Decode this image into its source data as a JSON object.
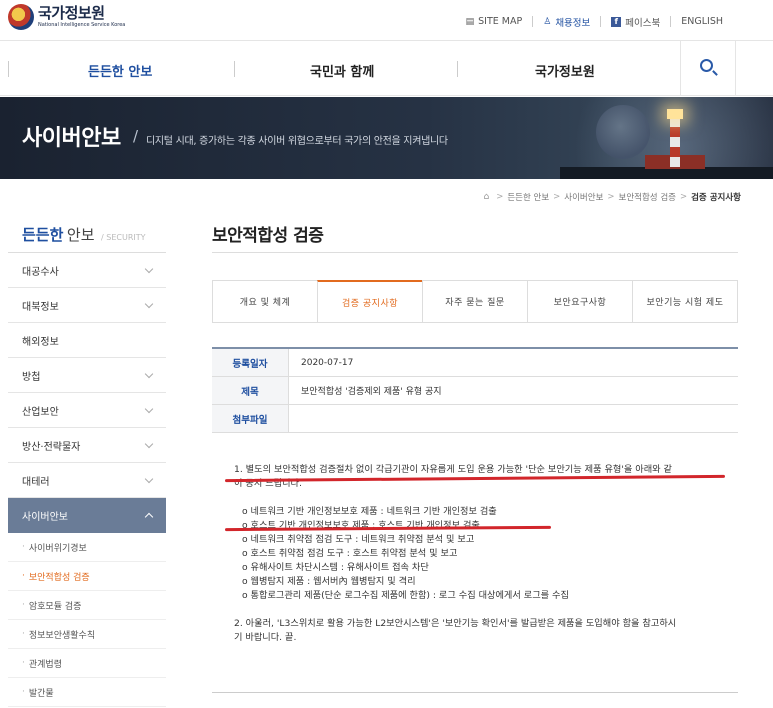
{
  "header": {
    "logo_title": "국가정보원",
    "logo_sub": "National Intelligence Service Korea",
    "util": [
      {
        "icon": "sitemap-icon",
        "glyph": "▤",
        "label": "SITE MAP"
      },
      {
        "icon": "person-icon",
        "glyph": "♙",
        "label": "채용정보"
      },
      {
        "icon": "facebook-icon",
        "glyph": "f",
        "label": "페이스북"
      },
      {
        "icon": "",
        "glyph": "",
        "label": "ENGLISH"
      }
    ]
  },
  "gnb": {
    "menus": [
      "든든한 안보",
      "국민과 함께",
      "국가정보원"
    ],
    "active_index": 0,
    "search_icon": "search-icon"
  },
  "hero": {
    "title": "사이버안보",
    "slash": "/",
    "description": "디지털 시대, 증가하는 각종 사이버 위협으로부터 국가의 안전을 지켜냅니다"
  },
  "breadcrumb": {
    "home_icon": "home-icon",
    "items": [
      "든든한 안보",
      "사이버안보",
      "보안적합성 검증"
    ],
    "current": "검증 공지사항"
  },
  "sidebar": {
    "title_strong": "든든한",
    "title_rest": "안보",
    "title_en": "/ SECURITY",
    "items": [
      {
        "label": "대공수사",
        "has_chevron": true
      },
      {
        "label": "대북정보",
        "has_chevron": true
      },
      {
        "label": "해외정보",
        "has_chevron": false
      },
      {
        "label": "방첩",
        "has_chevron": true
      },
      {
        "label": "산업보안",
        "has_chevron": true
      },
      {
        "label": "방산·전략물자",
        "has_chevron": true
      },
      {
        "label": "대테러",
        "has_chevron": true
      }
    ],
    "open_item": "사이버안보",
    "sub_items": [
      {
        "label": "사이버위기경보",
        "active": false
      },
      {
        "label": "보안적합성 검증",
        "active": true
      },
      {
        "label": "암호모듈 검증",
        "active": false
      },
      {
        "label": "정보보안생활수칙",
        "active": false
      },
      {
        "label": "관계법령",
        "active": false
      },
      {
        "label": "발간물",
        "active": false
      }
    ]
  },
  "content": {
    "page_title": "보안적합성 검증",
    "tabs": [
      {
        "label": "개요 및 체계",
        "active": false
      },
      {
        "label": "검증 공지사항",
        "active": true
      },
      {
        "label": "자주 묻는 질문",
        "active": false
      },
      {
        "label": "보안요구사항",
        "active": false
      },
      {
        "label": "보안기능 시험 제도",
        "active": false
      }
    ],
    "info": [
      {
        "th": "등록일자",
        "td": "2020-07-17"
      },
      {
        "th": "제목",
        "td": "보안적합성 '검증제외 제품' 유형 공지"
      },
      {
        "th": "첨부파일",
        "td": ""
      }
    ],
    "paragraph1_line1": "1. 별도의 보안적합성 검증절차 없이 각급기관이 자유롭게 도입 운용 가능한 '단순 보안기능 제품 유형'을 아래와 같",
    "paragraph1_line2": "이 공지 드립니다.",
    "list": [
      "o 네트워크 기반 개인정보보호 제품 : 네트워크 기반 개인정보 검출",
      "o 호스트 기반 개인정보보호 제품 : 호스트 기반 개인정보 검출",
      "o 네트워크 취약점 점검 도구 : 네트워크 취약점 분석 및 보고",
      "o 호스트 취약점 점검 도구 : 호스트 취약점 분석 및 보고",
      "o 유해사이트 차단시스템 : 유해사이트 접속 차단",
      "o 웹병탐지 제품 : 웹서버內 웹병탐지 및 격리",
      "o 통합로그관리 제품(단순 로그수집 제품에 한함) : 로그 수집 대상에게서 로그를 수집"
    ],
    "paragraph2_line1": "2. 아울러, 'L3스위치로 활용 가능한 L2보안시스템'은 '보안기능 확인서'를 발급받은 제품을 도입해야 함을 참고하시",
    "paragraph2_line2": "기 바랍니다. 끝."
  },
  "colors": {
    "brand_blue": "#1f4fa0",
    "active_orange": "#e26b1f",
    "annotation_red": "#d2262b",
    "sidebar_open_bg": "#6a7c97"
  }
}
